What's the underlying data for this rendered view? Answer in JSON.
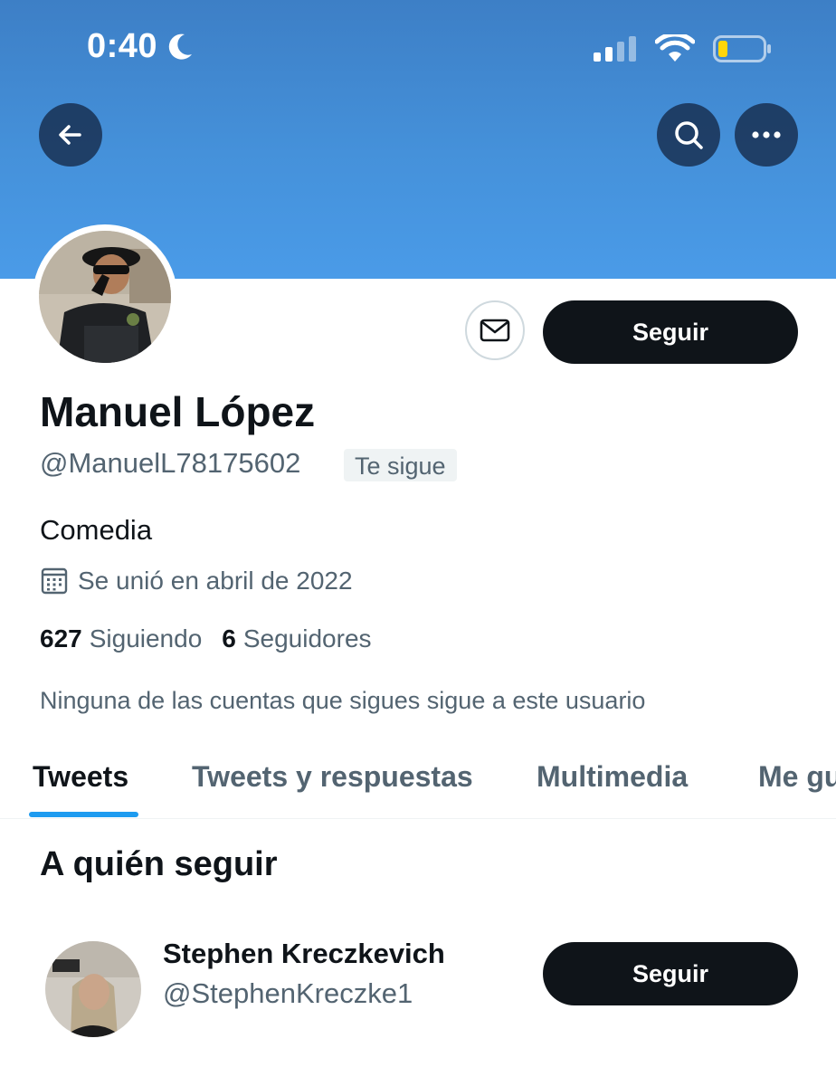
{
  "status_bar": {
    "time": "0:40"
  },
  "header": {
    "icons": [
      "back-arrow-icon",
      "search-icon",
      "more-icon"
    ]
  },
  "profile": {
    "name": "Manuel López",
    "handle": "@ManuelL78175602",
    "follows_you_badge": "Te sigue",
    "bio": "Comedia",
    "joined": "Se unió en abril de 2022",
    "following_count": "627",
    "following_label": "Siguiendo",
    "followers_count": "6",
    "followers_label": "Seguidores",
    "mutual_note": "Ninguna de las cuentas que sigues sigue a este usuario",
    "follow_button": "Seguir"
  },
  "tabs": [
    {
      "label": "Tweets",
      "active": true
    },
    {
      "label": "Tweets y respuestas",
      "active": false
    },
    {
      "label": "Multimedia",
      "active": false
    },
    {
      "label": "Me gu",
      "active": false
    }
  ],
  "who_to_follow": {
    "title": "A quién seguir",
    "items": [
      {
        "name": "Stephen Kreczkevich",
        "handle": "@StephenKreczke1",
        "button": "Seguir"
      }
    ]
  },
  "colors": {
    "banner": "#4591da",
    "accent": "#1d9bf0",
    "button_dark": "#0f1419",
    "secondary_text": "#536471"
  }
}
